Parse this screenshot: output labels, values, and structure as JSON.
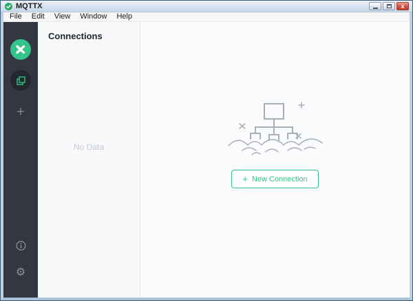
{
  "window": {
    "title": "MQTTX",
    "controls": {
      "minimize_icon": "—",
      "maximize_icon": "☐",
      "close_icon": "✕"
    }
  },
  "menu": {
    "items": [
      "File",
      "Edit",
      "View",
      "Window",
      "Help"
    ]
  },
  "sidebar": {
    "items": [
      {
        "name": "mqttx-logo-icon",
        "active": false
      },
      {
        "name": "connections-icon",
        "active": true
      },
      {
        "name": "new-connection-plus-icon",
        "active": false
      },
      {
        "name": "about-info-icon",
        "active": false
      },
      {
        "name": "settings-gear-icon",
        "active": false
      }
    ],
    "plus_icon": "+",
    "gear_icon": "⚙"
  },
  "connections_panel": {
    "title": "Connections",
    "empty_text": "No Data"
  },
  "main": {
    "illustration": "empty-network-sketch",
    "new_connection_button": {
      "icon": "+",
      "label": "New Connection"
    }
  },
  "colors": {
    "brand_green": "#34c388",
    "sidebar_bg": "#343741",
    "sidebar_active_bg": "#23272e",
    "panel_bg": "#f7f9fb",
    "main_bg": "#fafbfd",
    "titlebar_gradient_top": "#eaf1f9",
    "titlebar_gradient_bottom": "#c7d7e9",
    "window_border_blue": "#bdd1e3",
    "illustration_gray": "#a9adb5",
    "empty_text_gray": "#c5c9d0"
  }
}
